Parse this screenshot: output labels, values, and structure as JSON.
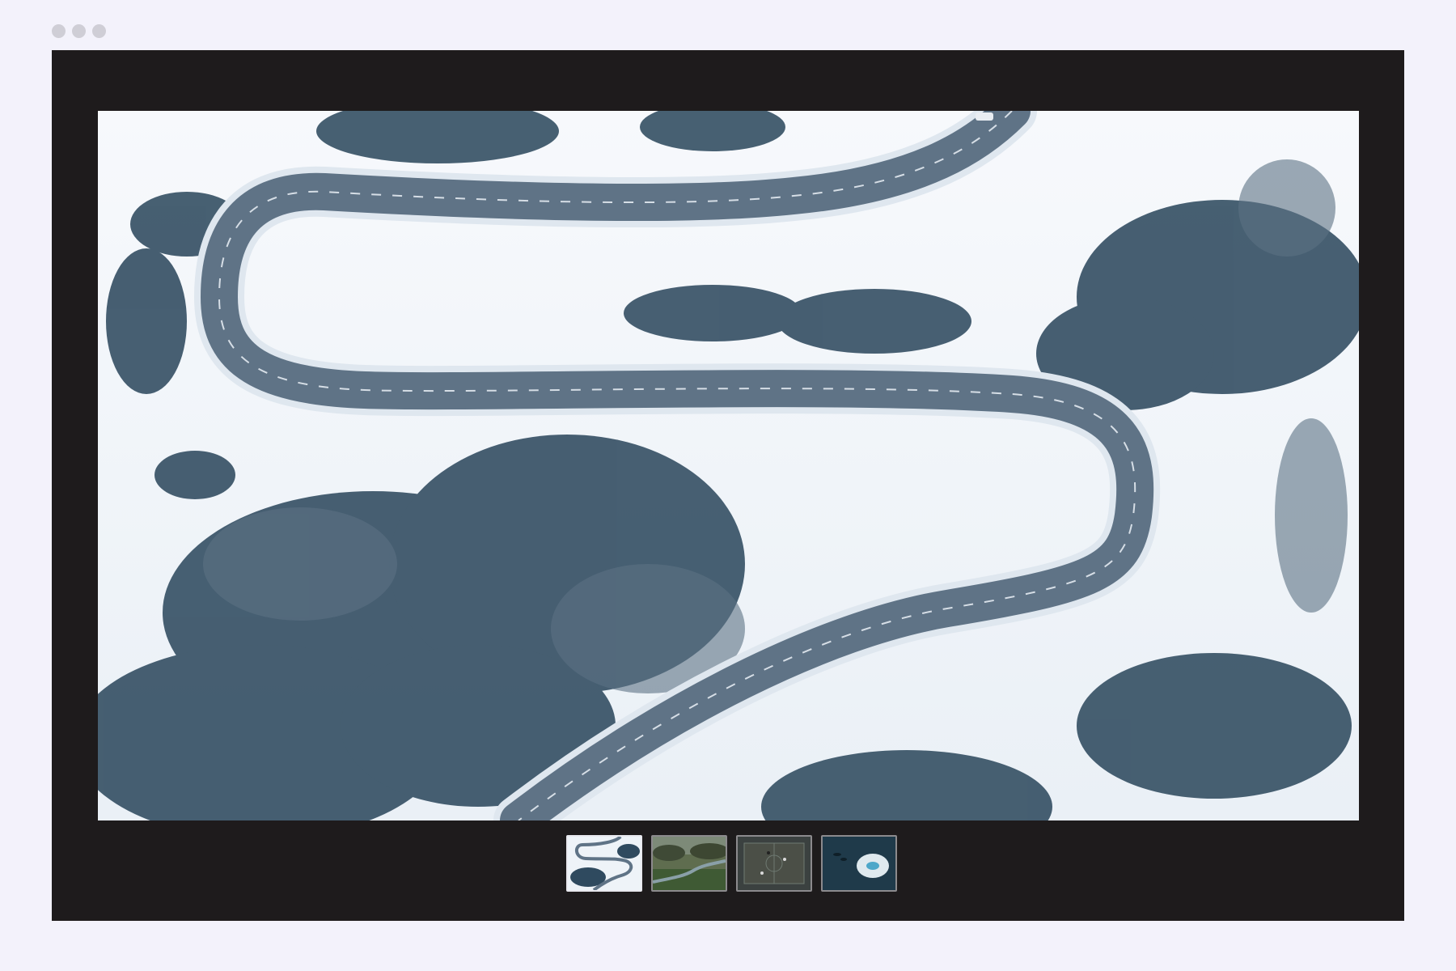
{
  "window": {
    "controls": [
      "window-dot",
      "window-dot",
      "window-dot"
    ]
  },
  "viewer": {
    "main_image": {
      "subject": "aerial-winding-snowy-road",
      "icon": "photo"
    },
    "thumbnails": [
      {
        "subject": "snowy-road",
        "active": true
      },
      {
        "subject": "river-valley",
        "active": false
      },
      {
        "subject": "court",
        "active": false
      },
      {
        "subject": "iceberg-water",
        "active": false
      }
    ]
  },
  "colors": {
    "page_background": "#f3f2fb",
    "frame_background": "#1e1b1c",
    "snow": "#f4f7fb",
    "road": "#5f7386",
    "trees": "#2f4a5f"
  }
}
